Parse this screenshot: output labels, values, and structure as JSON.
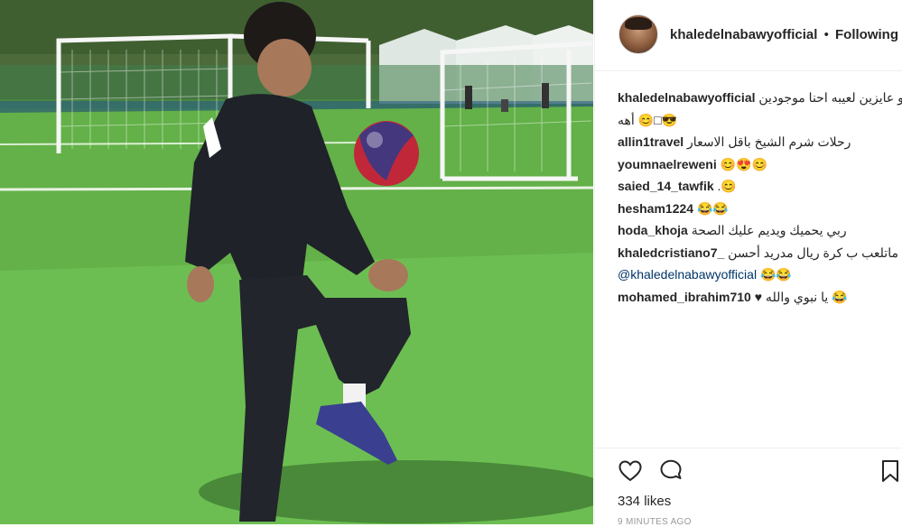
{
  "post": {
    "username": "khaledelnabawyofficial",
    "separator": "•",
    "follow_status": "Following"
  },
  "comments": [
    {
      "user": "khaledelnabawyofficial",
      "text": "لو عايزين لعيبه احنا موجودين",
      "text2": "😎□😊 أهه"
    },
    {
      "user": "allin1travel",
      "text": "رحلات شرم الشيخ باقل الاسعار"
    },
    {
      "user": "youmnaelreweni",
      "text": "😊😍😊"
    },
    {
      "user": "saied_14_tawfik",
      "text": ".😊"
    },
    {
      "user": "hesham1224",
      "text": "😂😂"
    },
    {
      "user": "hoda_khoja",
      "text": "ربي يحميك ويديم عليك الصحة"
    },
    {
      "user": "khaledcristiano7_",
      "text": "ماتلعب ب كرة ريال مدريد أحسن",
      "mention": "@khaledelnabawyofficial",
      "text2": "😂😂"
    },
    {
      "user": "mohamed_ibrahim710",
      "text": "😂 يا نبوي والله ♥"
    }
  ],
  "actions": {
    "like_icon": "heart-icon",
    "comment_icon": "comment-icon",
    "save_icon": "bookmark-icon"
  },
  "likes_text": "334 likes",
  "timestamp": "9 MINUTES AGO",
  "colors": {
    "text": "#262626",
    "mention": "#003569",
    "muted": "#999999",
    "border": "#efefef"
  }
}
